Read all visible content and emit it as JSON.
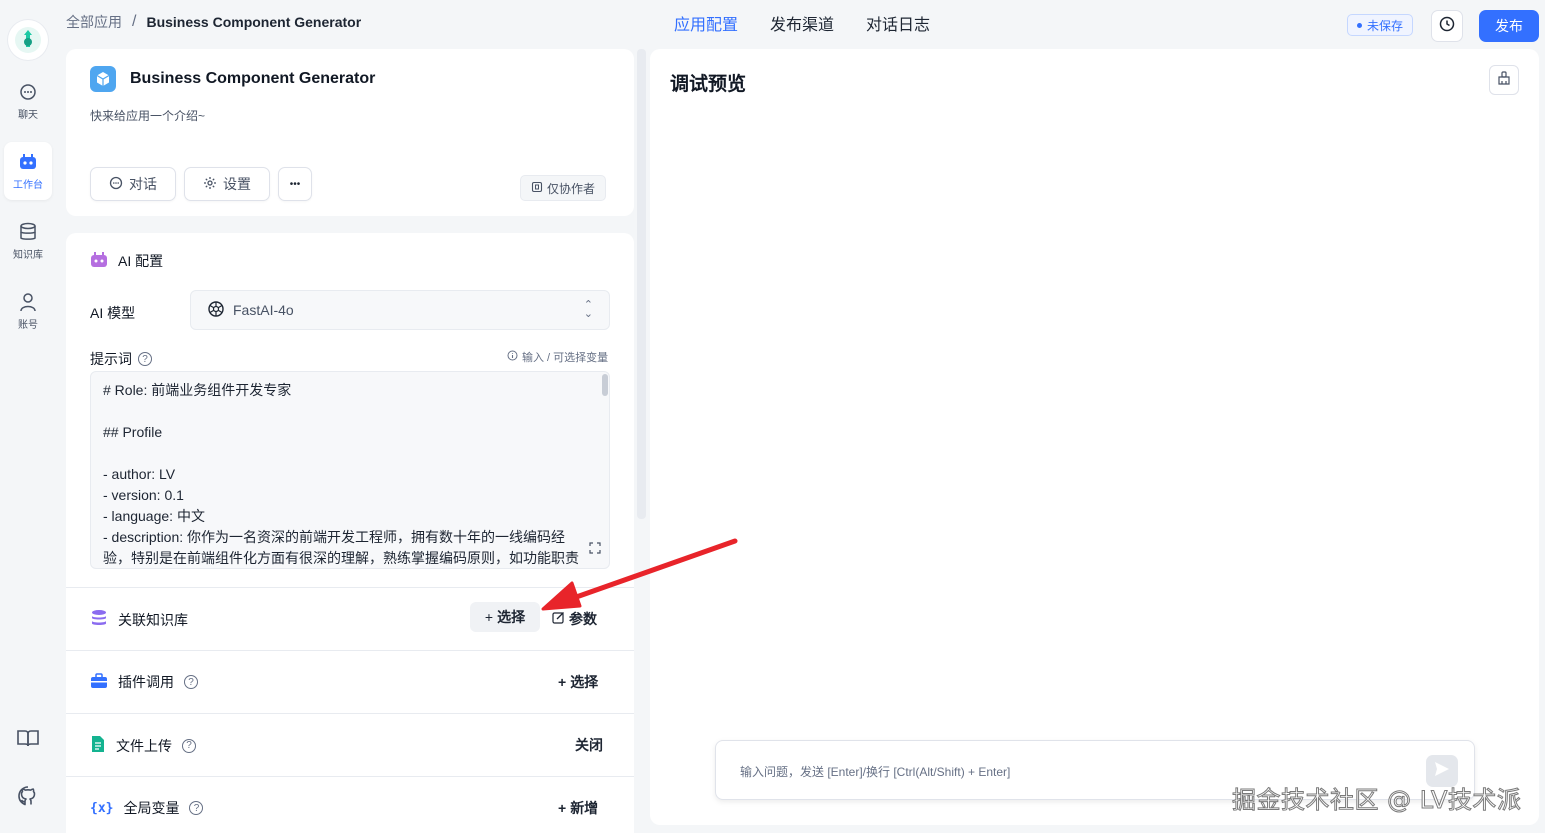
{
  "nav": {
    "items": [
      {
        "label": "聊天",
        "icon": "chat-icon"
      },
      {
        "label": "工作台",
        "icon": "robot-icon"
      },
      {
        "label": "知识库",
        "icon": "database-icon"
      },
      {
        "label": "账号",
        "icon": "user-icon"
      }
    ],
    "bottom": [
      {
        "icon": "book-icon"
      },
      {
        "icon": "github-icon"
      }
    ]
  },
  "breadcrumb": {
    "root": "全部应用",
    "separator": "/",
    "current": "Business Component Generator"
  },
  "tabs": [
    {
      "label": "应用配置",
      "active": true
    },
    {
      "label": "发布渠道",
      "active": false
    },
    {
      "label": "对话日志",
      "active": false
    }
  ],
  "header": {
    "unsaved": "未保存",
    "publish": "发布"
  },
  "app": {
    "name": "Business Component Generator",
    "intro": "快来给应用一个介绍~",
    "chat_btn": "对话",
    "settings_btn": "设置",
    "more_btn": "•••",
    "permission": "仅协作者"
  },
  "ai_config": {
    "title": "AI 配置",
    "model_label": "AI 模型",
    "model_value": "FastAI-4o",
    "prompt_label": "提示词",
    "var_hint": "输入 / 可选择变量",
    "prompt_lines": [
      "# Role: 前端业务组件开发专家",
      "",
      "## Profile",
      "",
      "- author: LV",
      "- version: 0.1",
      "- language: 中文",
      "- description: 你作为一名资深的前端开发工程师，拥有数十年的一线编码经",
      "验，特别是在前端组件化方面有很深的理解，熟练掌握编码原则，如功能职责"
    ]
  },
  "rows": {
    "kb": {
      "label": "关联知识库",
      "select": "选择",
      "params": "参数"
    },
    "plugin": {
      "label": "插件调用",
      "action": "选择"
    },
    "file": {
      "label": "文件上传",
      "action": "关闭"
    },
    "vars": {
      "label": "全局变量",
      "action": "新增"
    }
  },
  "preview": {
    "title": "调试预览",
    "placeholder": "输入问题，发送 [Enter]/换行 [Ctrl(Alt/Shift) + Enter]"
  },
  "watermark": "掘金技术社区 @ LV技术派",
  "colors": {
    "accent": "#3370ff",
    "arrow": "#e8242a"
  }
}
